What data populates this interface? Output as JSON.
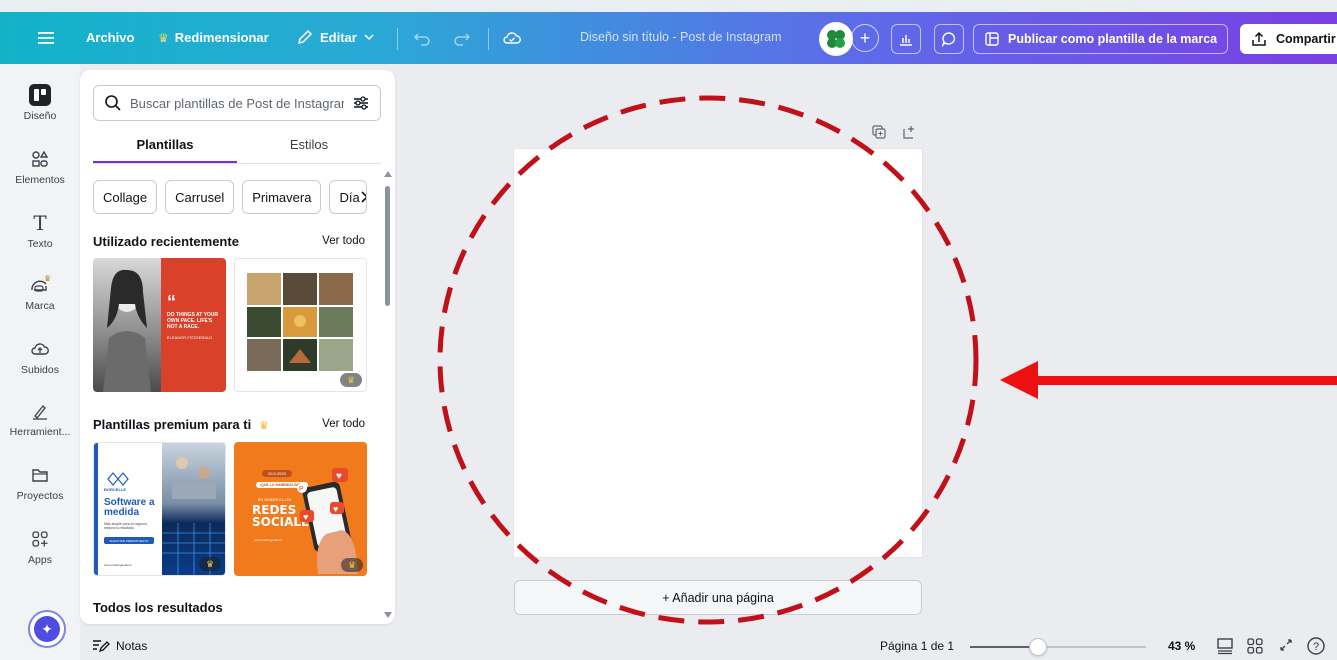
{
  "topbar": {
    "archivo": "Archivo",
    "redimensionar": "Redimensionar",
    "editar": "Editar",
    "doc_title": "Diseño sin título - Post de Instagram",
    "publish": "Publicar como plantilla de la marca",
    "share": "Compartir"
  },
  "rail": [
    {
      "label": "Diseño",
      "icon": "design-icon"
    },
    {
      "label": "Elementos",
      "icon": "elements-icon"
    },
    {
      "label": "Texto",
      "icon": "text-icon"
    },
    {
      "label": "Marca",
      "icon": "brand-icon"
    },
    {
      "label": "Subidos",
      "icon": "upload-icon"
    },
    {
      "label": "Herramient...",
      "icon": "tools-icon"
    },
    {
      "label": "Proyectos",
      "icon": "folder-icon"
    },
    {
      "label": "Apps",
      "icon": "apps-icon"
    }
  ],
  "panel": {
    "search_placeholder": "Buscar plantillas de Post de Instagram",
    "tabs": [
      "Plantillas",
      "Estilos"
    ],
    "chips": [
      "Collage",
      "Carrusel",
      "Primavera",
      "Día"
    ],
    "recent_title": "Utilizado recientemente",
    "premium_title": "Plantillas premium para ti",
    "see_all": "Ver todo",
    "all_results": "Todos los resultados",
    "templates": {
      "quote_text": "DO THINGS AT YOUR OWN PACE. LIFE'S NOT A RACE.",
      "quote_author": "ELEANOR FITZGERALD",
      "quote_mark": "“",
      "software_brand": "BORCELLE",
      "software_title": "Software a medida",
      "software_sub": "Más simple para tu negocio, mejora tu resultado.",
      "software_btn": "SOLICITAR PRESUPUESTO",
      "software_url": "www.unsitiogenial.es",
      "social_date": "20.5.2025",
      "social_tag": "¡QUE LO HAREMOS BIEN!",
      "social_line": "EN VENDER EL LAS",
      "social_title": "REDES SOCIALES",
      "social_url": "www.unsitiogenial.es"
    }
  },
  "canvas": {
    "add_page": "+ Añadir una página"
  },
  "bottombar": {
    "notes": "Notas",
    "page_info": "Página 1 de 1",
    "zoom": "43 %",
    "zoom_value": 43
  },
  "colors": {
    "accent": "#7d2ae8",
    "annotation": "#c0101a",
    "arrow": "#ee1111"
  }
}
